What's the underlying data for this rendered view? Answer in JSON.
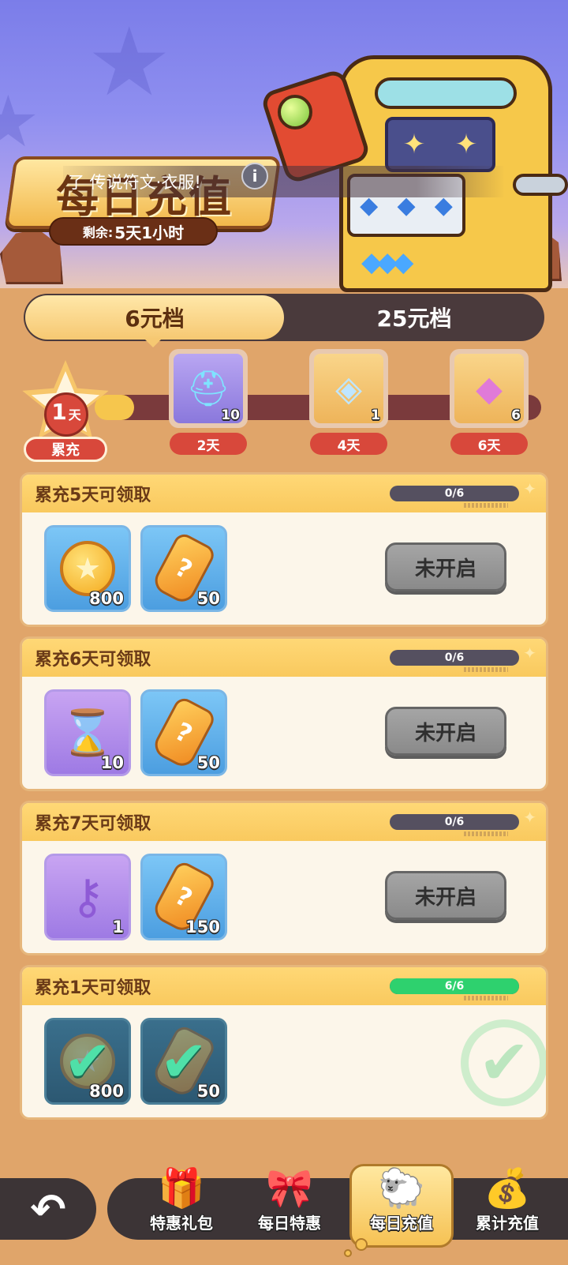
{
  "header": {
    "title": "每日充值",
    "remaining_label": "剩余:",
    "remaining_value": "5天1小时",
    "marquee": "了 传说符文·衣服!",
    "info_icon": "i"
  },
  "tabs": [
    {
      "label": "6元档",
      "active": true
    },
    {
      "label": "25元档",
      "active": false
    }
  ],
  "progress": {
    "current_day": "1",
    "day_unit": "天",
    "current_label": "累充",
    "fill_fraction": 0.08,
    "milestones": [
      {
        "day": "2天",
        "qty": "10",
        "icon": "spirit-helmet-icon"
      },
      {
        "day": "4天",
        "qty": "1",
        "icon": "crystal-ring-icon"
      },
      {
        "day": "6天",
        "qty": "6",
        "icon": "rainbow-cube-icon"
      }
    ]
  },
  "rewards": [
    {
      "title": "累充5天可领取",
      "progress_text": "0/6",
      "progress_fraction": 0,
      "status": "未开启",
      "claimed": false,
      "items": [
        {
          "icon": "gold-coin-icon",
          "qty": "800",
          "bg": "blue"
        },
        {
          "icon": "potion-bottle-icon",
          "qty": "50",
          "bg": "blue"
        }
      ]
    },
    {
      "title": "累充6天可领取",
      "progress_text": "0/6",
      "progress_fraction": 0,
      "status": "未开启",
      "claimed": false,
      "items": [
        {
          "icon": "hourglass-icon",
          "qty": "10",
          "bg": "purple"
        },
        {
          "icon": "potion-bottle-icon",
          "qty": "50",
          "bg": "blue"
        }
      ]
    },
    {
      "title": "累充7天可领取",
      "progress_text": "0/6",
      "progress_fraction": 0,
      "status": "未开启",
      "claimed": false,
      "items": [
        {
          "icon": "purple-key-icon",
          "qty": "1",
          "bg": "purple"
        },
        {
          "icon": "potion-bottle-icon",
          "qty": "150",
          "bg": "blue"
        }
      ]
    },
    {
      "title": "累充1天可领取",
      "progress_text": "6/6",
      "progress_fraction": 1,
      "status": "",
      "claimed": true,
      "items": [
        {
          "icon": "gold-coin-icon",
          "qty": "800",
          "bg": "dark"
        },
        {
          "icon": "potion-bottle-icon",
          "qty": "50",
          "bg": "dark"
        }
      ]
    }
  ],
  "nav": {
    "back_icon": "back-arrow-icon",
    "items": [
      {
        "label": "特惠礼包",
        "icon": "gift-box-icon",
        "active": false
      },
      {
        "label": "每日特惠",
        "icon": "gift-card-icon",
        "active": false
      },
      {
        "label": "每日充值",
        "icon": "mascot-icon",
        "active": true
      },
      {
        "label": "累计充值",
        "icon": "treasure-chest-icon",
        "active": false
      }
    ]
  },
  "colors": {
    "accent_red": "#d8483b",
    "accent_gold": "#f6c64d",
    "progress_green": "#2ed16e",
    "page_bg": "#e0a56a"
  }
}
